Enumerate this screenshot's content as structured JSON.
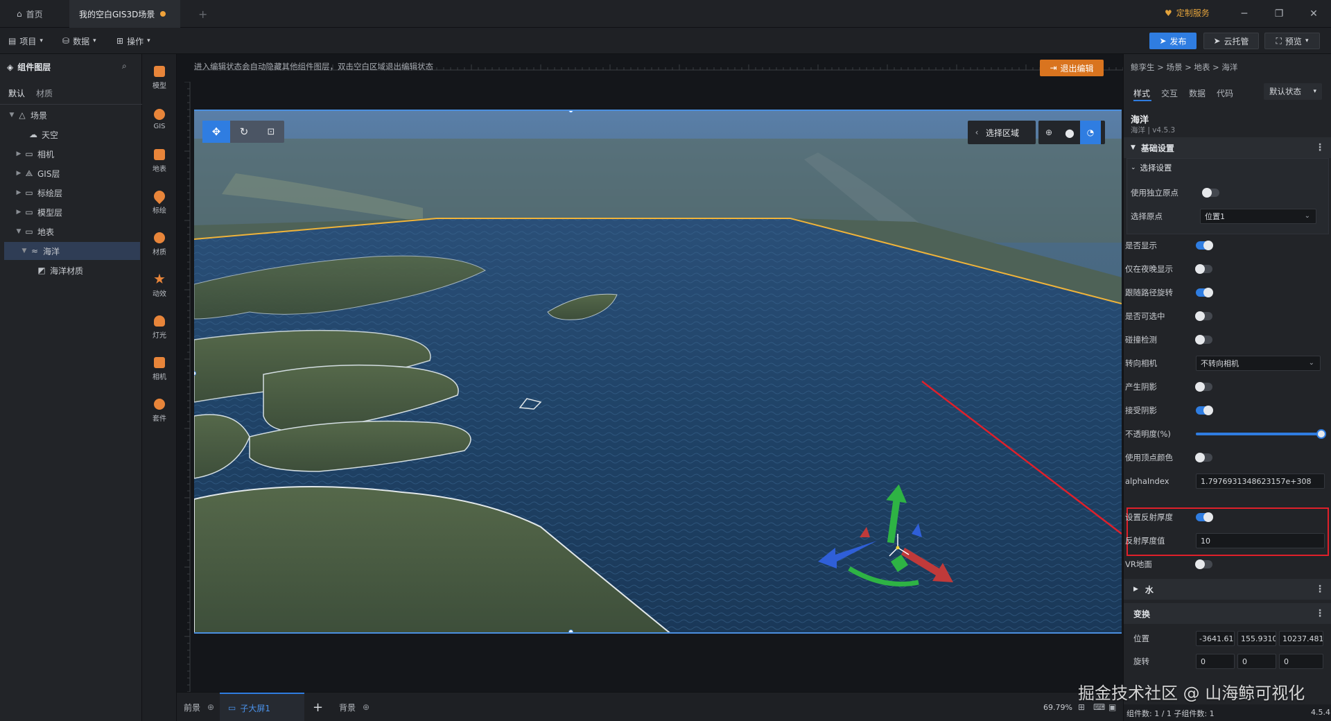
{
  "titlebar": {
    "tabs": [
      {
        "label": "首页"
      },
      {
        "label": "我的空白GIS3D场景"
      }
    ],
    "custom_service": "定制服务"
  },
  "menubar": {
    "menus": [
      {
        "label": "项目"
      },
      {
        "label": "数据"
      },
      {
        "label": "操作"
      }
    ],
    "publish": "发布",
    "cloud": "云托管",
    "preview": "预览"
  },
  "leftpanel": {
    "title": "组件图层",
    "tabs": [
      "默认",
      "材质"
    ],
    "tree": [
      {
        "label": "场景"
      },
      {
        "label": "天空"
      },
      {
        "label": "相机"
      },
      {
        "label": "GIS层"
      },
      {
        "label": "标绘层"
      },
      {
        "label": "模型层"
      },
      {
        "label": "地表"
      },
      {
        "label": "海洋"
      },
      {
        "label": "海洋材质"
      }
    ]
  },
  "toolbox": {
    "tools": [
      {
        "label": "模型"
      },
      {
        "label": "GIS"
      },
      {
        "label": "地表"
      },
      {
        "label": "标绘"
      },
      {
        "label": "材质"
      },
      {
        "label": "动效"
      },
      {
        "label": "灯光"
      },
      {
        "label": "相机"
      },
      {
        "label": "套件"
      }
    ]
  },
  "canvas": {
    "hint": "进入编辑状态会自动隐藏其他组件图层，双击空白区域退出编辑状态",
    "exit_edit": "退出编辑",
    "select_area": "选择区域"
  },
  "rightpanel": {
    "breadcrumb": "鲸孪生 > 场景 > 地表 > 海洋",
    "tabs": [
      "样式",
      "交互",
      "数据",
      "代码"
    ],
    "state": "默认状态",
    "component_name": "海洋",
    "component_version": "海洋 | v4.5.3",
    "basic_settings": "基础设置",
    "select_settings": "选择设置",
    "use_independent_origin": "使用独立原点",
    "select_origin_label": "选择原点",
    "select_origin_value": "位置1",
    "rows": [
      {
        "label": "是否显示",
        "on": true
      },
      {
        "label": "仅在夜晚显示",
        "on": false
      },
      {
        "label": "跟随路径旋转",
        "on": true
      },
      {
        "label": "是否可选中",
        "on": false
      },
      {
        "label": "碰撞检测",
        "on": false
      }
    ],
    "face_camera_label": "转向相机",
    "face_camera_value": "不转向相机",
    "cast_shadow": "产生阴影",
    "receive_shadow": "接受阴影",
    "opacity_label": "不透明度(%)",
    "opacity_value": 1.0,
    "vertex_color": "使用顶点颜色",
    "alpha_index_label": "alphaIndex",
    "alpha_index_value": "1.7976931348623157e+308",
    "reflect_thickness_toggle": "设置反射厚度",
    "reflect_thickness_label": "反射厚度值",
    "reflect_thickness_value": "10",
    "vr_ground": "VR地面",
    "water_section": "水",
    "transform_section": "变换",
    "position_label": "位置",
    "position_values": [
      "-3641.612;",
      "155.93109",
      "10237.481"
    ],
    "rotation_label": "旋转",
    "rotation_values": [
      "0",
      "0",
      "0"
    ],
    "status_right": "4.5.4",
    "stats": "组件数: 1 / 1    子组件数: 1"
  },
  "bottombar": {
    "foreground": "前景",
    "screen_tab": "子大屏1",
    "background": "背景",
    "zoom": "69.79%"
  },
  "watermark": "掘金技术社区 @ 山海鲸可视化",
  "colors": {
    "accent": "#2f7de1",
    "orange": "#d9741f",
    "highlight_red": "#e0202a"
  }
}
